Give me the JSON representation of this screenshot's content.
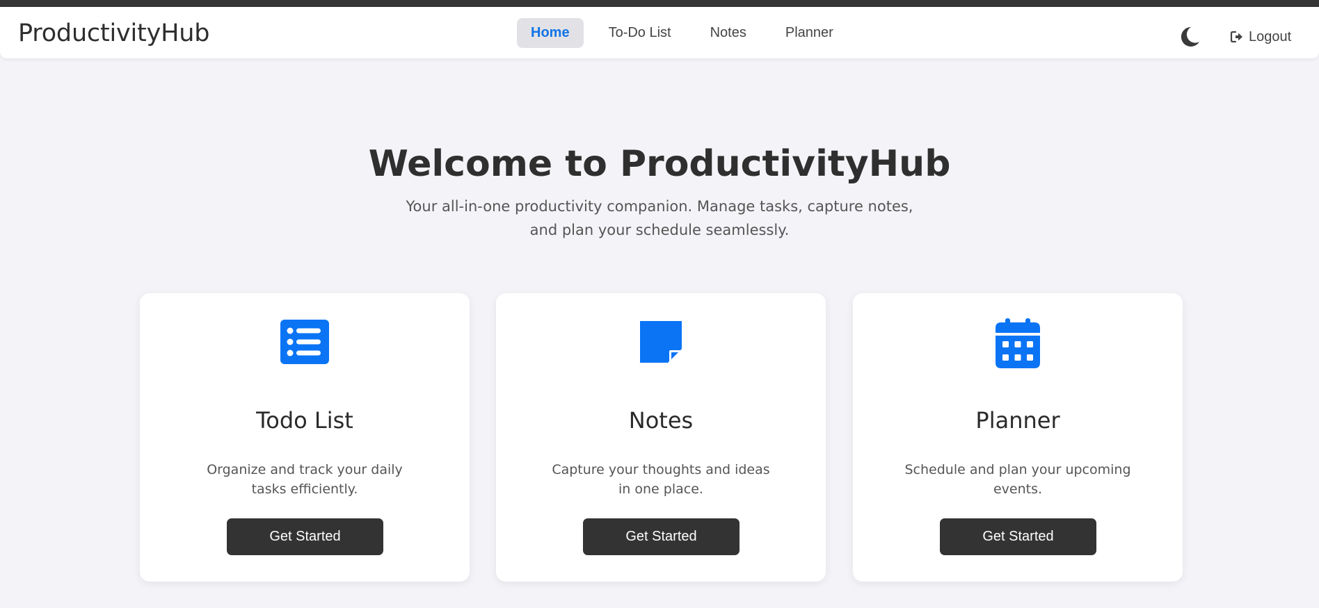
{
  "app": {
    "brand": "ProductivityHub",
    "accent_color": "#1273e6",
    "icon_color": "#0a74f5"
  },
  "nav": {
    "links": [
      {
        "label": "Home",
        "active": true
      },
      {
        "label": "To-Do List",
        "active": false
      },
      {
        "label": "Notes",
        "active": false
      },
      {
        "label": "Planner",
        "active": false
      }
    ],
    "theme_icon": "moon-icon",
    "logout_icon": "sign-out-icon",
    "logout_label": "Logout"
  },
  "hero": {
    "title": "Welcome to ProductivityHub",
    "subtitle": "Your all-in-one productivity companion. Manage tasks, capture notes, and plan your schedule seamlessly."
  },
  "cards": [
    {
      "icon": "list-icon",
      "title": "Todo List",
      "description": "Organize and track your daily tasks efficiently.",
      "button_label": "Get Started"
    },
    {
      "icon": "sticky-note-icon",
      "title": "Notes",
      "description": "Capture your thoughts and ideas in one place.",
      "button_label": "Get Started"
    },
    {
      "icon": "calendar-icon",
      "title": "Planner",
      "description": "Schedule and plan your upcoming events.",
      "button_label": "Get Started"
    }
  ]
}
